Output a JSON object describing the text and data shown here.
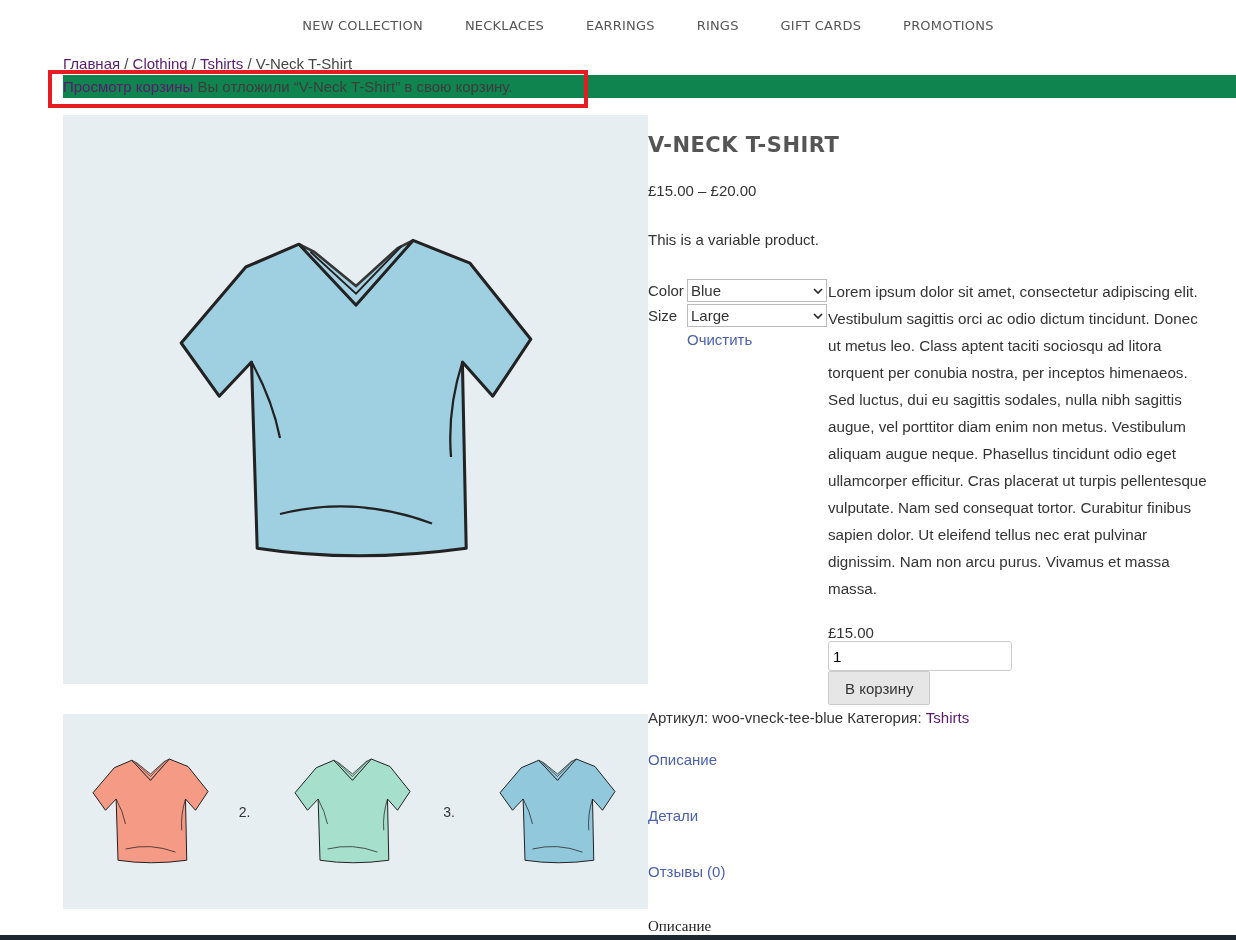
{
  "nav": [
    {
      "label": "NEW COLLECTION"
    },
    {
      "label": "NECKLACES"
    },
    {
      "label": "EARRINGS"
    },
    {
      "label": "RINGS"
    },
    {
      "label": "GIFT CARDS"
    },
    {
      "label": "PROMOTIONS"
    }
  ],
  "breadcrumb": [
    {
      "label": "Главная",
      "link": true
    },
    {
      "label": "Clothing",
      "link": true
    },
    {
      "label": "Tshirts",
      "link": true
    },
    {
      "label": "V-Neck T-Shirt",
      "link": false
    }
  ],
  "breadcrumb_separator": "/",
  "notice": {
    "link": "Просмотр корзины",
    "message": "Вы отложили “V-Neck T-Shirt” в свою корзину.",
    "highlighted": true
  },
  "product": {
    "title": "V-NECK T-SHIRT",
    "price_range": "£15.00 – £20.00",
    "short_description": "This is a variable product.",
    "variations": [
      {
        "label": "Color",
        "value": "Blue"
      },
      {
        "label": "Size",
        "value": "Large"
      }
    ],
    "clear_link": "Очистить",
    "description": "Lorem ipsum dolor sit amet, consectetur adipiscing elit. Vestibulum sagittis orci ac odio dictum tincidunt. Donec ut metus leo. Class aptent taciti sociosqu ad litora torquent per conubia nostra, per inceptos himenaeos. Sed luctus, dui eu sagittis sodales, nulla nibh sagittis augue, vel porttitor diam enim non metus. Vestibulum aliquam augue neque. Phasellus tincidunt odio eget ullamcorper efficitur. Cras placerat ut turpis pellentesque vulputate. Nam sed consequat tortor. Curabitur finibus sapien dolor. Ut eleifend tellus nec erat pulvinar dignissim. Nam non arcu purus. Vivamus et massa massa.",
    "variation_price": "£15.00",
    "quantity": "1",
    "add_to_cart": "В корзину",
    "sku_label": "Артикул:",
    "sku": "woo-vneck-tee-blue",
    "category_label": "Категория:",
    "category": "Tshirts"
  },
  "thumbnails": [
    {
      "color": "#f59a84"
    },
    {
      "number": "2.",
      "color": "#a6e0cc"
    },
    {
      "number": "3.",
      "color": "#92c8dc"
    }
  ],
  "tabs": [
    {
      "label": "Описание"
    },
    {
      "label": "Детали"
    },
    {
      "label": "Отзывы (0)"
    }
  ],
  "tab_heading": "Описание"
}
